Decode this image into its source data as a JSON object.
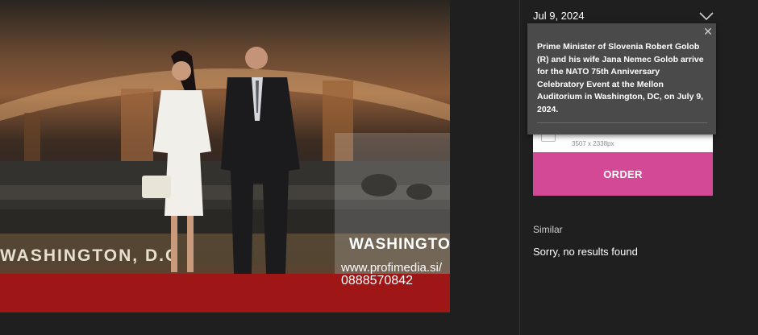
{
  "photo": {
    "watermark_url": "www.profimedia.si/",
    "watermark_phone": "0888570842",
    "backdrop_text": "WASHINGTON, D.C",
    "backdrop_text_right": "WASHINGTO"
  },
  "sidebar": {
    "date": "Jul 9, 2024",
    "license_dimensions": "3507 x 2338px",
    "order_label": "ORDER",
    "similar_label": "Similar",
    "no_results": "Sorry, no results found"
  },
  "tooltip": {
    "caption": "Prime Minister of Slovenia Robert Golob (R) and his wife Jana Nemec Golob arrive for the NATO 75th Anniversary Celebratory Event at the Mellon Auditorium in Washington, DC, on July 9, 2024."
  },
  "colors": {
    "order_button": "#d34995",
    "background": "#1f1f1f",
    "tooltip": "#4a4a4a"
  }
}
